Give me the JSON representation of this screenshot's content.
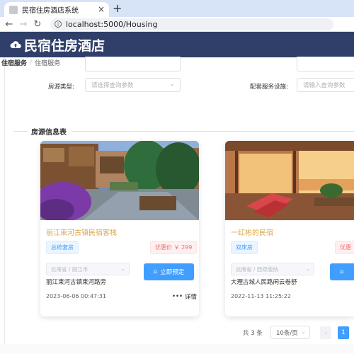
{
  "browser": {
    "tab_title": "民宿住房酒店系统",
    "new_tab_symbol": "+",
    "close_symbol": "×",
    "url": "localhost:5000/Housing"
  },
  "header": {
    "brand": "民宿住房酒店"
  },
  "breadcrumb": {
    "root": "住宿服务",
    "separator": "/",
    "current": "住宿服务"
  },
  "filters": {
    "house_type_label": "房源类型:",
    "house_type_placeholder": "请选择查询参数",
    "facility_label": "配套服务设施:",
    "facility_placeholder": "请输入查询参数"
  },
  "section": {
    "title": "房源信息表"
  },
  "cards": [
    {
      "name": "丽江束河古镇民宿客栈",
      "tag": "总统套房",
      "price": "优惠价 ￥ 299",
      "region_placeholder": "云南省 / 丽江市",
      "book_label": "立即预定",
      "address": "丽江束河古镇束河路旁",
      "date": "2023-06-06 00:47:31",
      "detail_label": "详情"
    },
    {
      "name": "一红彬的民宿",
      "tag": "双床房",
      "price": "优惠",
      "region_placeholder": "云南省 / 西双版纳",
      "book_label": "",
      "address": "大理古城人民路闲云卷舒",
      "date": "2022-11-13 11:25:22",
      "detail_label": ""
    }
  ],
  "pagination": {
    "total": "共 3 条",
    "page_size": "10条/页",
    "prev": "‹",
    "current_page": "1"
  },
  "colors": {
    "header_bg": "#2f3f69",
    "primary": "#409eff",
    "card_title": "#d9a94d",
    "price": "#f56c6c"
  }
}
